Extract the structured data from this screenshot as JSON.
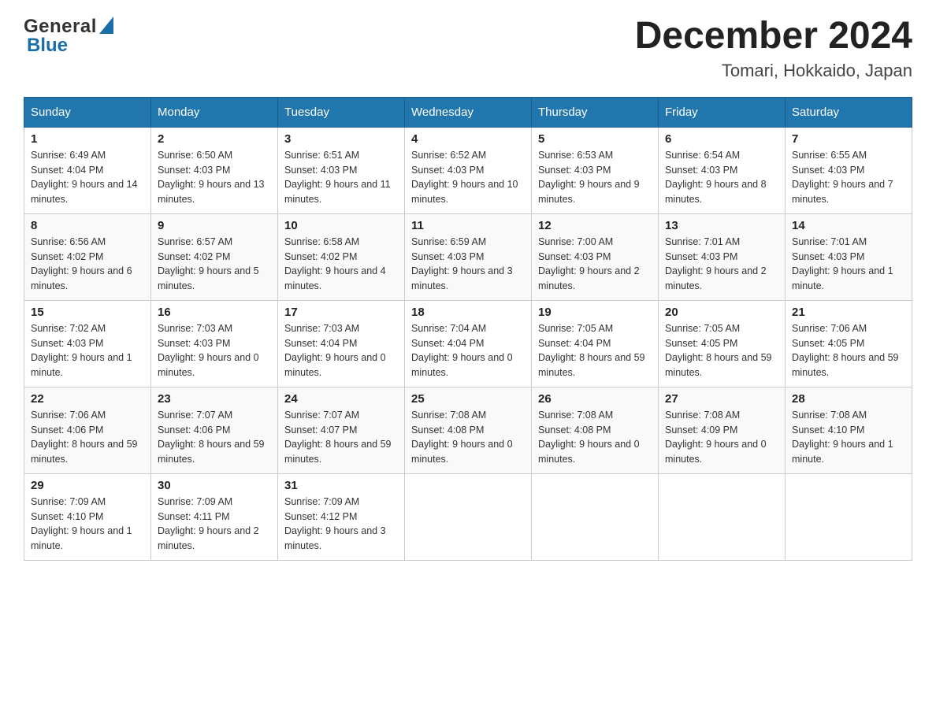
{
  "header": {
    "logo_general": "General",
    "logo_blue": "Blue",
    "month_title": "December 2024",
    "location": "Tomari, Hokkaido, Japan"
  },
  "days_of_week": [
    "Sunday",
    "Monday",
    "Tuesday",
    "Wednesday",
    "Thursday",
    "Friday",
    "Saturday"
  ],
  "weeks": [
    [
      {
        "day": "1",
        "sunrise": "Sunrise: 6:49 AM",
        "sunset": "Sunset: 4:04 PM",
        "daylight": "Daylight: 9 hours and 14 minutes."
      },
      {
        "day": "2",
        "sunrise": "Sunrise: 6:50 AM",
        "sunset": "Sunset: 4:03 PM",
        "daylight": "Daylight: 9 hours and 13 minutes."
      },
      {
        "day": "3",
        "sunrise": "Sunrise: 6:51 AM",
        "sunset": "Sunset: 4:03 PM",
        "daylight": "Daylight: 9 hours and 11 minutes."
      },
      {
        "day": "4",
        "sunrise": "Sunrise: 6:52 AM",
        "sunset": "Sunset: 4:03 PM",
        "daylight": "Daylight: 9 hours and 10 minutes."
      },
      {
        "day": "5",
        "sunrise": "Sunrise: 6:53 AM",
        "sunset": "Sunset: 4:03 PM",
        "daylight": "Daylight: 9 hours and 9 minutes."
      },
      {
        "day": "6",
        "sunrise": "Sunrise: 6:54 AM",
        "sunset": "Sunset: 4:03 PM",
        "daylight": "Daylight: 9 hours and 8 minutes."
      },
      {
        "day": "7",
        "sunrise": "Sunrise: 6:55 AM",
        "sunset": "Sunset: 4:03 PM",
        "daylight": "Daylight: 9 hours and 7 minutes."
      }
    ],
    [
      {
        "day": "8",
        "sunrise": "Sunrise: 6:56 AM",
        "sunset": "Sunset: 4:02 PM",
        "daylight": "Daylight: 9 hours and 6 minutes."
      },
      {
        "day": "9",
        "sunrise": "Sunrise: 6:57 AM",
        "sunset": "Sunset: 4:02 PM",
        "daylight": "Daylight: 9 hours and 5 minutes."
      },
      {
        "day": "10",
        "sunrise": "Sunrise: 6:58 AM",
        "sunset": "Sunset: 4:02 PM",
        "daylight": "Daylight: 9 hours and 4 minutes."
      },
      {
        "day": "11",
        "sunrise": "Sunrise: 6:59 AM",
        "sunset": "Sunset: 4:03 PM",
        "daylight": "Daylight: 9 hours and 3 minutes."
      },
      {
        "day": "12",
        "sunrise": "Sunrise: 7:00 AM",
        "sunset": "Sunset: 4:03 PM",
        "daylight": "Daylight: 9 hours and 2 minutes."
      },
      {
        "day": "13",
        "sunrise": "Sunrise: 7:01 AM",
        "sunset": "Sunset: 4:03 PM",
        "daylight": "Daylight: 9 hours and 2 minutes."
      },
      {
        "day": "14",
        "sunrise": "Sunrise: 7:01 AM",
        "sunset": "Sunset: 4:03 PM",
        "daylight": "Daylight: 9 hours and 1 minute."
      }
    ],
    [
      {
        "day": "15",
        "sunrise": "Sunrise: 7:02 AM",
        "sunset": "Sunset: 4:03 PM",
        "daylight": "Daylight: 9 hours and 1 minute."
      },
      {
        "day": "16",
        "sunrise": "Sunrise: 7:03 AM",
        "sunset": "Sunset: 4:03 PM",
        "daylight": "Daylight: 9 hours and 0 minutes."
      },
      {
        "day": "17",
        "sunrise": "Sunrise: 7:03 AM",
        "sunset": "Sunset: 4:04 PM",
        "daylight": "Daylight: 9 hours and 0 minutes."
      },
      {
        "day": "18",
        "sunrise": "Sunrise: 7:04 AM",
        "sunset": "Sunset: 4:04 PM",
        "daylight": "Daylight: 9 hours and 0 minutes."
      },
      {
        "day": "19",
        "sunrise": "Sunrise: 7:05 AM",
        "sunset": "Sunset: 4:04 PM",
        "daylight": "Daylight: 8 hours and 59 minutes."
      },
      {
        "day": "20",
        "sunrise": "Sunrise: 7:05 AM",
        "sunset": "Sunset: 4:05 PM",
        "daylight": "Daylight: 8 hours and 59 minutes."
      },
      {
        "day": "21",
        "sunrise": "Sunrise: 7:06 AM",
        "sunset": "Sunset: 4:05 PM",
        "daylight": "Daylight: 8 hours and 59 minutes."
      }
    ],
    [
      {
        "day": "22",
        "sunrise": "Sunrise: 7:06 AM",
        "sunset": "Sunset: 4:06 PM",
        "daylight": "Daylight: 8 hours and 59 minutes."
      },
      {
        "day": "23",
        "sunrise": "Sunrise: 7:07 AM",
        "sunset": "Sunset: 4:06 PM",
        "daylight": "Daylight: 8 hours and 59 minutes."
      },
      {
        "day": "24",
        "sunrise": "Sunrise: 7:07 AM",
        "sunset": "Sunset: 4:07 PM",
        "daylight": "Daylight: 8 hours and 59 minutes."
      },
      {
        "day": "25",
        "sunrise": "Sunrise: 7:08 AM",
        "sunset": "Sunset: 4:08 PM",
        "daylight": "Daylight: 9 hours and 0 minutes."
      },
      {
        "day": "26",
        "sunrise": "Sunrise: 7:08 AM",
        "sunset": "Sunset: 4:08 PM",
        "daylight": "Daylight: 9 hours and 0 minutes."
      },
      {
        "day": "27",
        "sunrise": "Sunrise: 7:08 AM",
        "sunset": "Sunset: 4:09 PM",
        "daylight": "Daylight: 9 hours and 0 minutes."
      },
      {
        "day": "28",
        "sunrise": "Sunrise: 7:08 AM",
        "sunset": "Sunset: 4:10 PM",
        "daylight": "Daylight: 9 hours and 1 minute."
      }
    ],
    [
      {
        "day": "29",
        "sunrise": "Sunrise: 7:09 AM",
        "sunset": "Sunset: 4:10 PM",
        "daylight": "Daylight: 9 hours and 1 minute."
      },
      {
        "day": "30",
        "sunrise": "Sunrise: 7:09 AM",
        "sunset": "Sunset: 4:11 PM",
        "daylight": "Daylight: 9 hours and 2 minutes."
      },
      {
        "day": "31",
        "sunrise": "Sunrise: 7:09 AM",
        "sunset": "Sunset: 4:12 PM",
        "daylight": "Daylight: 9 hours and 3 minutes."
      },
      null,
      null,
      null,
      null
    ]
  ]
}
